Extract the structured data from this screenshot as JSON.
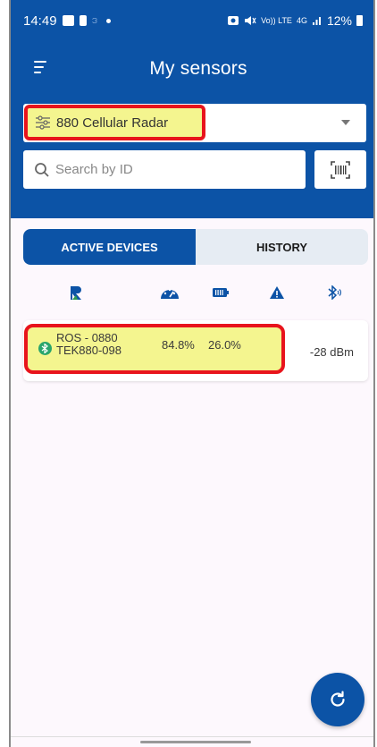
{
  "status_bar": {
    "time": "14:49",
    "right_network": "Vo)) LTE",
    "right_gen": "4G",
    "battery": "12%"
  },
  "app_bar": {
    "title": "My sensors",
    "menu_icon": "hamburger-menu-icon"
  },
  "sensor_selector": {
    "selected": "880 Cellular Radar",
    "icon": "filter-sliders-icon",
    "highlighted": true
  },
  "search": {
    "placeholder": "Search by ID",
    "value": "",
    "scan_icon": "barcode-scan-icon"
  },
  "tabs": [
    {
      "label": "ACTIVE DEVICES",
      "active": true
    },
    {
      "label": "HISTORY",
      "active": false
    }
  ],
  "column_icons": [
    "brand-r-logo-icon",
    "gauge-icon",
    "battery-icon",
    "warning-icon",
    "bluetooth-signal-icon"
  ],
  "devices": [
    {
      "name": "ROS - 0880",
      "id": "TEK880-098",
      "level": "84.8%",
      "battery": "26.0%",
      "rssi": "-28 dBm",
      "connection_icon": "bluetooth-icon",
      "highlighted": true
    }
  ],
  "fab": {
    "icon": "refresh-icon"
  },
  "colors": {
    "primary": "#0c53a6",
    "highlight_fill": "#f4f58f",
    "highlight_border": "#e8141c",
    "bluetooth_badge": "#29a56c"
  }
}
